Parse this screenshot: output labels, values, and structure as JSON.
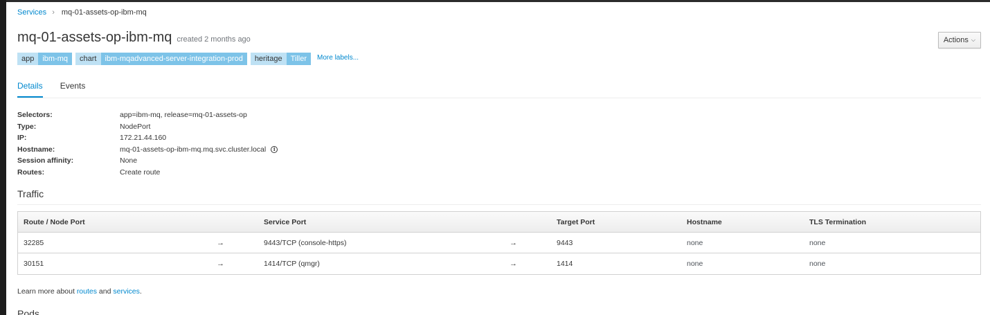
{
  "breadcrumb": {
    "parent": "Services",
    "separator": "›",
    "current": "mq-01-assets-op-ibm-mq"
  },
  "header": {
    "title": "mq-01-assets-op-ibm-mq",
    "created": "created 2 months ago",
    "actions_label": "Actions"
  },
  "labels": [
    {
      "key": "app",
      "value": "ibm-mq"
    },
    {
      "key": "chart",
      "value": "ibm-mqadvanced-server-integration-prod"
    },
    {
      "key": "heritage",
      "value": "Tiller"
    }
  ],
  "more_labels": "More labels...",
  "tabs": [
    {
      "label": "Details",
      "active": true
    },
    {
      "label": "Events",
      "active": false
    }
  ],
  "details": {
    "selectors": {
      "key": "Selectors:",
      "value": "app=ibm-mq, release=mq-01-assets-op"
    },
    "type": {
      "key": "Type:",
      "value": "NodePort"
    },
    "ip": {
      "key": "IP:",
      "value": "172.21.44.160"
    },
    "hostname": {
      "key": "Hostname:",
      "value": "mq-01-assets-op-ibm-mq.mq.svc.cluster.local"
    },
    "session_affinity": {
      "key": "Session affinity:",
      "value": "None"
    },
    "routes": {
      "key": "Routes:",
      "value": "Create route"
    }
  },
  "traffic": {
    "title": "Traffic",
    "columns": [
      "Route / Node Port",
      "Service Port",
      "Target Port",
      "Hostname",
      "TLS Termination"
    ],
    "arrow": "→",
    "rows": [
      {
        "node_port": "32285",
        "service_port": "9443/TCP (console-https)",
        "target_port": "9443",
        "hostname": "none",
        "tls": "none"
      },
      {
        "node_port": "30151",
        "service_port": "1414/TCP (qmgr)",
        "target_port": "1414",
        "hostname": "none",
        "tls": "none"
      }
    ]
  },
  "learn_more": {
    "prefix": "Learn more about ",
    "routes": "routes",
    "and": " and ",
    "services": "services",
    "suffix": "."
  },
  "pods": {
    "title": "Pods"
  },
  "colors": {
    "link": "#0088ce",
    "label_key_bg": "#bee1f4",
    "label_value_bg": "#7dc3e8"
  }
}
